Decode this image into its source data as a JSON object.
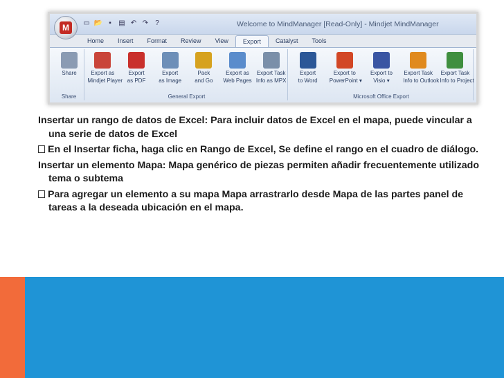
{
  "window": {
    "title": "Welcome to MindManager [Read-Only] - Mindjet MindManager",
    "office_button_letter": "M"
  },
  "quick_access": [
    "new-icon",
    "open-icon",
    "save-icon",
    "print-icon",
    "undo-icon",
    "redo-icon",
    "help-icon"
  ],
  "tabs": [
    {
      "label": "Home"
    },
    {
      "label": "Insert"
    },
    {
      "label": "Format"
    },
    {
      "label": "Review"
    },
    {
      "label": "View"
    },
    {
      "label": "Export",
      "active": true
    },
    {
      "label": "Catalyst"
    },
    {
      "label": "Tools"
    }
  ],
  "ribbon": {
    "groups": [
      {
        "label": "Share",
        "buttons": [
          {
            "lines": [
              "Share",
              ""
            ],
            "icon": "share-icon",
            "color": "#8a9bb3"
          }
        ]
      },
      {
        "label": "General Export",
        "buttons": [
          {
            "lines": [
              "Export as",
              "Mindjet Player"
            ],
            "icon": "player-icon",
            "color": "#c9453a"
          },
          {
            "lines": [
              "Export",
              "as PDF"
            ],
            "icon": "pdf-icon",
            "color": "#c9302c"
          },
          {
            "lines": [
              "Export",
              "as Image"
            ],
            "icon": "image-icon",
            "color": "#6d8fb8"
          },
          {
            "lines": [
              "Pack",
              "and Go"
            ],
            "icon": "pack-icon",
            "color": "#d6a21f"
          },
          {
            "lines": [
              "Export as",
              "Web Pages"
            ],
            "icon": "web-icon",
            "color": "#5a8ccc"
          },
          {
            "lines": [
              "Export Task",
              "Info as MPX"
            ],
            "icon": "mpx-icon",
            "color": "#7a8fa9"
          }
        ]
      },
      {
        "label": "Microsoft Office Export",
        "buttons": [
          {
            "lines": [
              "Export",
              "to Word"
            ],
            "icon": "word-icon",
            "color": "#2b5797"
          },
          {
            "lines": [
              "Export to",
              "PowerPoint ▾"
            ],
            "icon": "powerpoint-icon",
            "color": "#d24726"
          },
          {
            "lines": [
              "Export to",
              "Visio ▾"
            ],
            "icon": "visio-icon",
            "color": "#3955a3"
          },
          {
            "lines": [
              "Export Task",
              "Info to Outlook"
            ],
            "icon": "outlook-icon",
            "color": "#e08a1e"
          },
          {
            "lines": [
              "Export Task",
              "Info to Project"
            ],
            "icon": "project-icon",
            "color": "#3f8f3f"
          }
        ]
      }
    ]
  },
  "paragraphs": [
    {
      "bullet": false,
      "text": "Insertar un rango de datos de Excel: Para incluir datos de Excel en el mapa, puede vincular a una serie de datos de Excel"
    },
    {
      "bullet": true,
      "text": "En el Insertar ficha, haga clic en Rango de Excel, Se define el rango en el cuadro de diálogo."
    },
    {
      "bullet": false,
      "text": "Insertar un elemento Mapa: Mapa genérico de piezas permiten añadir frecuentemente utilizado tema o subtema"
    },
    {
      "bullet": true,
      "text": "Para agregar un elemento a su mapa Mapa arrastrarlo desde Mapa de las partes panel de tareas a la deseada ubicación en el mapa."
    }
  ],
  "colors": {
    "orange_band": "#f26b3a",
    "blue_band": "#1f94d6"
  }
}
